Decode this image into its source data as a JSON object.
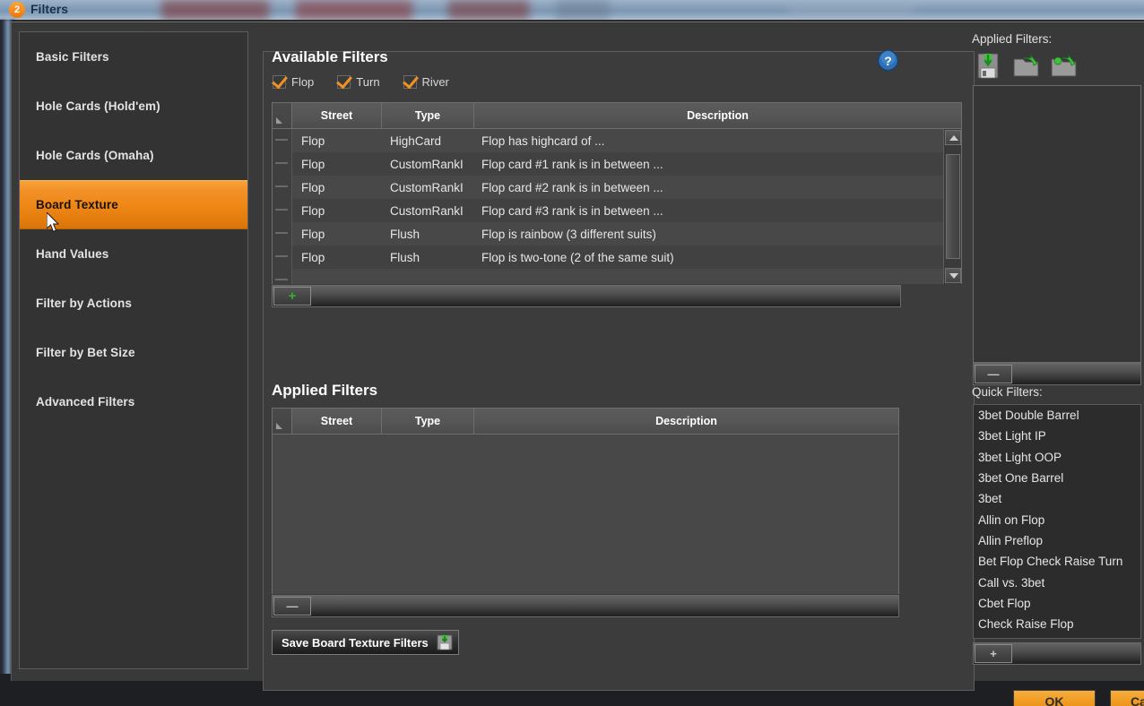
{
  "window": {
    "badge": "2",
    "title": "Filters"
  },
  "sidebar": {
    "items": [
      {
        "label": "Basic Filters",
        "selected": false
      },
      {
        "label": "Hole Cards (Hold'em)",
        "selected": false
      },
      {
        "label": "Hole Cards (Omaha)",
        "selected": false
      },
      {
        "label": "Board Texture",
        "selected": true
      },
      {
        "label": "Hand Values",
        "selected": false
      },
      {
        "label": "Filter by Actions",
        "selected": false
      },
      {
        "label": "Filter by Bet Size",
        "selected": false
      },
      {
        "label": "Advanced Filters",
        "selected": false
      }
    ]
  },
  "available": {
    "title": "Available Filters",
    "help_icon": "help-circle-icon",
    "streets": [
      {
        "label": "Flop",
        "checked": true
      },
      {
        "label": "Turn",
        "checked": true
      },
      {
        "label": "River",
        "checked": true
      }
    ],
    "columns": [
      "Street",
      "Type",
      "Description"
    ],
    "rows": [
      {
        "street": "Flop",
        "type": "HighCard",
        "description": "Flop has highcard of ..."
      },
      {
        "street": "Flop",
        "type": "CustomRankI",
        "description": "Flop card #1 rank is in between ..."
      },
      {
        "street": "Flop",
        "type": "CustomRankI",
        "description": "Flop card #2 rank is in between ..."
      },
      {
        "street": "Flop",
        "type": "CustomRankI",
        "description": "Flop card #3 rank is in between ..."
      },
      {
        "street": "Flop",
        "type": "Flush",
        "description": "Flop is rainbow (3 different suits)"
      },
      {
        "street": "Flop",
        "type": "Flush",
        "description": "Flop is two-tone (2 of the same suit)"
      }
    ],
    "add_button": "+"
  },
  "applied": {
    "title": "Applied Filters",
    "columns": [
      "Street",
      "Type",
      "Description"
    ],
    "rows": [],
    "remove_button": "—"
  },
  "save_button": {
    "label": "Save Board Texture Filters",
    "icon": "save-disk-icon"
  },
  "right_panel": {
    "applied_label": "Applied Filters:",
    "toolbar": [
      {
        "name": "save-filters-icon"
      },
      {
        "name": "open-filters-icon"
      },
      {
        "name": "import-filters-icon"
      }
    ],
    "applied_scroll_button": "—",
    "quick_label": "Quick Filters:",
    "quick_filters": [
      "3bet Double Barrel",
      "3bet Light IP",
      "3bet Light OOP",
      "3bet One Barrel",
      "3bet",
      "Allin on Flop",
      "Allin Preflop",
      "Bet Flop Check Raise Turn",
      "Call vs. 3bet",
      "Cbet Flop",
      "Check Raise Flop"
    ],
    "quick_add_button": "+"
  },
  "footer": {
    "ok": "OK",
    "cancel": "Cancel"
  },
  "colors": {
    "accent_orange": "#ef8715",
    "panel_bg": "#3c3c3c",
    "dialog_bg": "#393939",
    "green": "#33b033",
    "help_blue": "#2f6fb5"
  }
}
